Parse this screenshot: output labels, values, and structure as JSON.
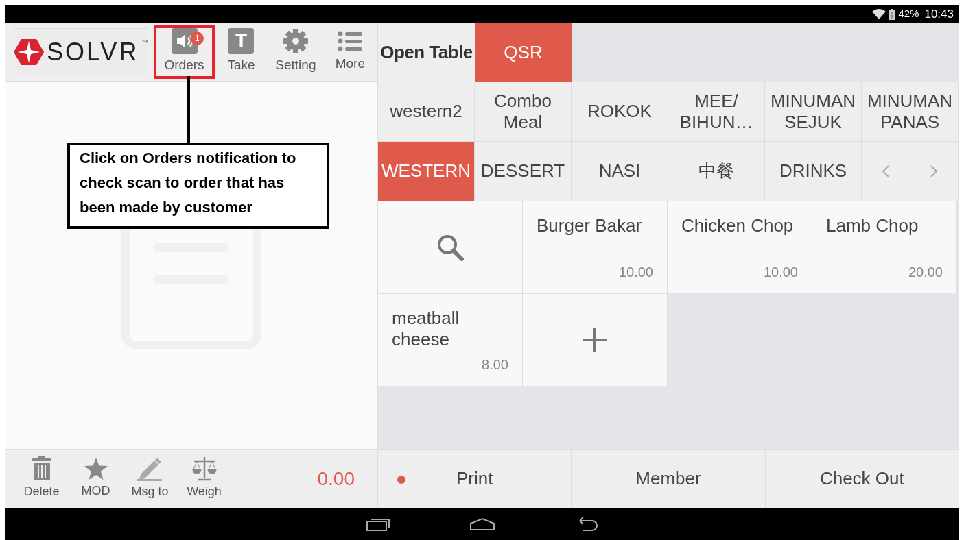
{
  "status_bar": {
    "battery": "42%",
    "time": "10:43"
  },
  "logo": {
    "name": "SOLVR",
    "trademark": "™"
  },
  "toolbar": [
    {
      "kind": "speaker",
      "label": "Orders",
      "badge": "1",
      "highlighted": true
    },
    {
      "kind": "letter",
      "label": "Take",
      "icon_text": "T",
      "highlighted": false
    },
    {
      "kind": "gear",
      "label": "Setting",
      "highlighted": false
    },
    {
      "kind": "list",
      "label": "More",
      "highlighted": false
    }
  ],
  "annotation": {
    "text": "Click on Orders notification to check scan to order that has been made by customer"
  },
  "order_actions": [
    {
      "kind": "trash",
      "label": "Delete"
    },
    {
      "kind": "star",
      "label": "MOD"
    },
    {
      "kind": "pencil",
      "label": "Msg to"
    },
    {
      "kind": "scale",
      "label": "Weigh"
    }
  ],
  "total": "0.00",
  "table_label": "Open Table",
  "modes": [
    {
      "label": "QSR",
      "selected": true
    }
  ],
  "categories": [
    {
      "label": "western2",
      "selected": false
    },
    {
      "label": "Combo Meal",
      "selected": false
    },
    {
      "label": "ROKOK",
      "selected": false
    },
    {
      "label": "MEE/ BIHUN…",
      "selected": false
    },
    {
      "label": "MINUMAN SEJUK",
      "selected": false
    },
    {
      "label": "MINUMAN PANAS",
      "selected": false
    },
    {
      "label": "WESTERN",
      "selected": true
    },
    {
      "label": "DESSERT",
      "selected": false
    },
    {
      "label": "NASI",
      "selected": false
    },
    {
      "label": "中餐",
      "selected": false
    },
    {
      "label": "DRINKS",
      "selected": false
    }
  ],
  "menu_items": [
    {
      "kind": "search"
    },
    {
      "kind": "item",
      "name": "Burger Bakar",
      "price": "10.00"
    },
    {
      "kind": "item",
      "name": "Chicken Chop",
      "price": "10.00"
    },
    {
      "kind": "item",
      "name": "Lamb Chop",
      "price": "20.00"
    },
    {
      "kind": "item",
      "name": "meatball cheese",
      "price": "8.00"
    },
    {
      "kind": "add"
    }
  ],
  "bottom_actions": [
    {
      "label": "Print",
      "indicator": true
    },
    {
      "label": "Member",
      "indicator": false
    },
    {
      "label": "Check Out",
      "indicator": false
    }
  ]
}
